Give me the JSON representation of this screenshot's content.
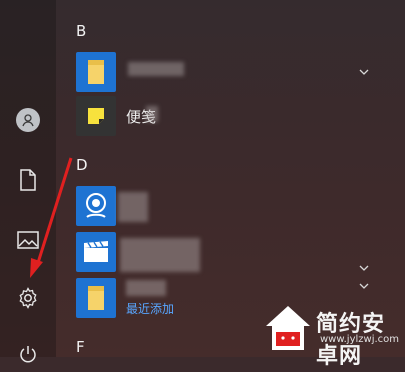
{
  "groups": [
    {
      "letter": "B"
    },
    {
      "letter": "D"
    },
    {
      "letter": "F"
    }
  ],
  "apps": [
    {
      "label": "",
      "tile_color": "#1e73d2",
      "icon": "folder-icon"
    },
    {
      "label": "便笺",
      "tile_color": "#333333",
      "icon": "sticky-note-icon"
    },
    {
      "label": "",
      "tile_color": "#1e73d2",
      "icon": "map-pin-icon"
    },
    {
      "label": "",
      "tile_color": "#1e73d2",
      "icon": "clapper-icon"
    },
    {
      "label": "",
      "sublabel": "最近添加",
      "tile_color": "#1e73d2",
      "icon": "folder-icon"
    }
  ],
  "rail": [
    "user-avatar-icon",
    "document-icon",
    "pictures-icon",
    "settings-icon",
    "power-icon"
  ],
  "watermark": {
    "title": "简约安卓网",
    "url": "www.jylzwj.com"
  },
  "colors": {
    "accent_blue": "#1e73d2",
    "link_blue": "#58a6ff",
    "arrow_red": "#e02020"
  }
}
